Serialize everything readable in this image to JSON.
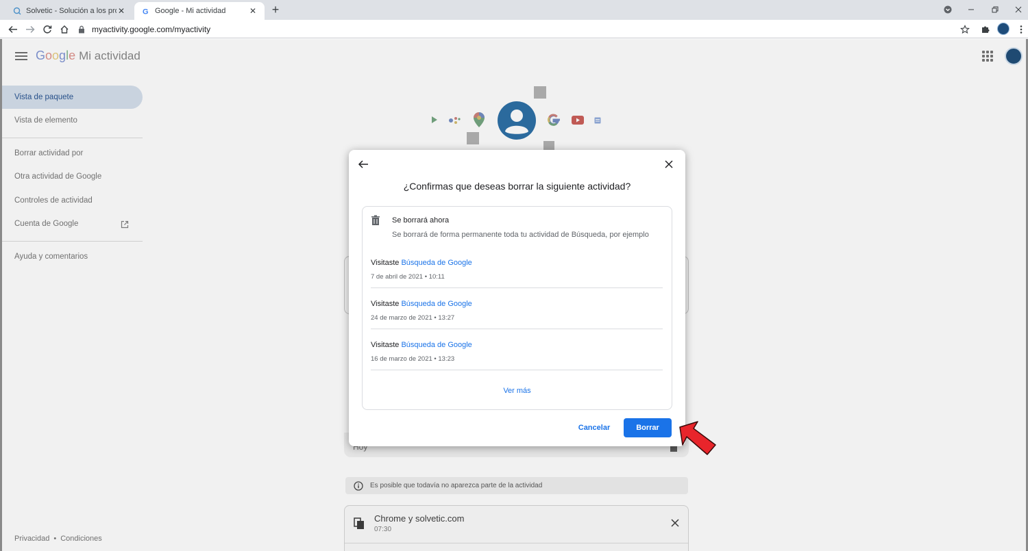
{
  "browser": {
    "tabs": [
      {
        "title": "Solvetic - Solución a los problem",
        "active": false
      },
      {
        "title": "Google - Mi actividad",
        "active": true
      }
    ],
    "url": "myactivity.google.com/myactivity"
  },
  "header": {
    "brand_g": "G",
    "brand_o1": "o",
    "brand_o2": "o",
    "brand_g2": "g",
    "brand_l": "l",
    "brand_e": "e",
    "title": "Mi actividad"
  },
  "sidebar": {
    "items": [
      {
        "label": "Vista de paquete",
        "selected": true
      },
      {
        "label": "Vista de elemento"
      },
      {
        "label": "Borrar actividad por"
      },
      {
        "label": "Otra actividad de Google"
      },
      {
        "label": "Controles de actividad"
      },
      {
        "label": "Cuenta de Google"
      },
      {
        "label": "Ayuda y comentarios"
      }
    ],
    "footer_privacy": "Privacidad",
    "footer_sep": "•",
    "footer_terms": "Condiciones"
  },
  "background": {
    "today_label": "Hoy",
    "notice": "Es posible que todavía no aparezca parte de la actividad",
    "chrome_card": {
      "title": "Chrome y solvetic.com",
      "time": "07:30"
    }
  },
  "dialog": {
    "title": "¿Confirmas que deseas borrar la siguiente actividad?",
    "heading": "Se borrará ahora",
    "subtext": "Se borrará de forma permanente toda tu actividad de Búsqueda, por ejemplo",
    "items": [
      {
        "prefix": "Visitaste",
        "link": "Búsqueda de Google",
        "date": "7 de abril de 2021 • 10:11"
      },
      {
        "prefix": "Visitaste",
        "link": "Búsqueda de Google",
        "date": "24 de marzo de 2021 • 13:27"
      },
      {
        "prefix": "Visitaste",
        "link": "Búsqueda de Google",
        "date": "16 de marzo de 2021 • 13:23"
      }
    ],
    "more": "Ver más",
    "cancel": "Cancelar",
    "confirm": "Borrar"
  },
  "colors": {
    "accent": "#1a73e8",
    "annotation_arrow": "#e8252b"
  }
}
